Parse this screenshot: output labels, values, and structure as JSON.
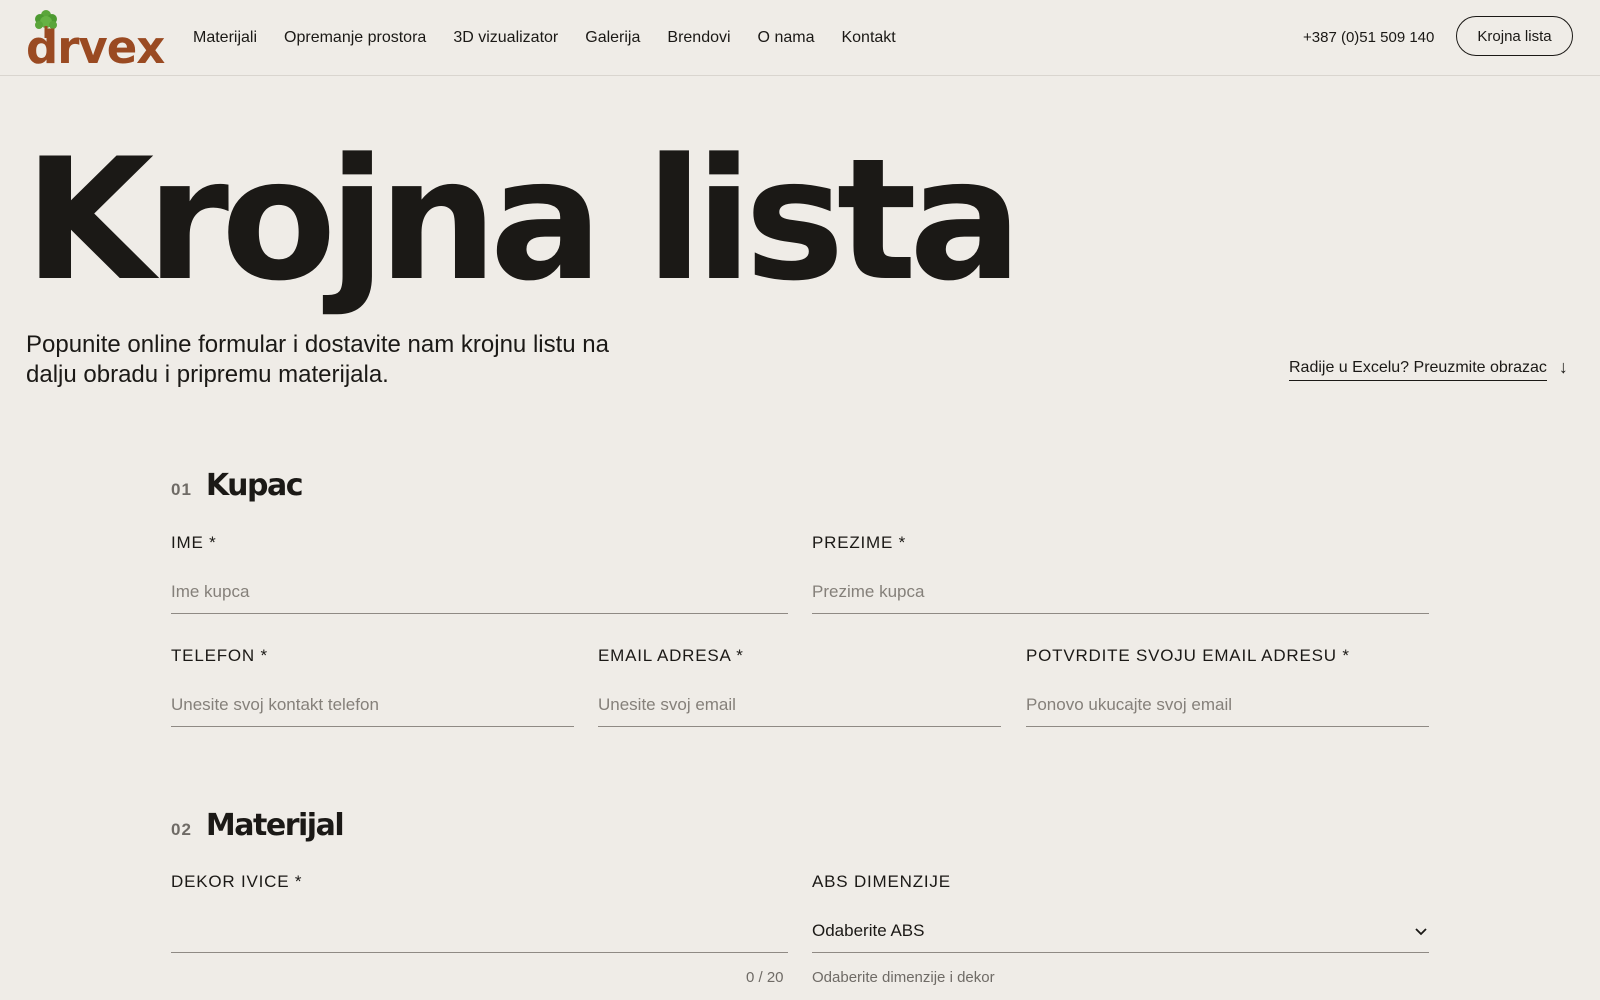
{
  "header": {
    "logo_text": "drvex",
    "nav": [
      "Materijali",
      "Opremanje prostora",
      "3D vizualizator",
      "Galerija",
      "Brendovi",
      "O nama",
      "Kontakt"
    ],
    "phone": "+387 (0)51 509 140",
    "cta_label": "Krojna lista"
  },
  "hero": {
    "title": "Krojna lista",
    "intro": "Popunite online formular i dostavite nam krojnu listu na dalju obradu i pripremu materijala.",
    "excel_link": "Radije u Excelu? Preuzmite obrazac",
    "excel_arrow": "↓"
  },
  "sections": {
    "kupac": {
      "num": "01",
      "title": "Kupac",
      "ime": {
        "label": "Ime *",
        "placeholder": "Ime kupca"
      },
      "prezime": {
        "label": "Prezime *",
        "placeholder": "Prezime kupca"
      },
      "telefon": {
        "label": "Telefon *",
        "placeholder": "Unesite svoj kontakt telefon"
      },
      "email": {
        "label": "Email adresa *",
        "placeholder": "Unesite svoj email"
      },
      "email_confirm": {
        "label": "Potvrdite svoju email adresu *",
        "placeholder": "Ponovo ukucajte svoj email"
      }
    },
    "materijal": {
      "num": "02",
      "title": "Materijal",
      "dekor": {
        "label": "Dekor ivice *",
        "value": "",
        "counter": "0 / 20"
      },
      "abs": {
        "label": "ABS dimenzije",
        "selected": "Odaberite ABS",
        "hint": "Odaberite dimenzije i dekor"
      }
    }
  },
  "colors": {
    "background": "#efece7",
    "text": "#1b1916",
    "logo_brown": "#9a4a22",
    "logo_green": "#5aa53a"
  }
}
